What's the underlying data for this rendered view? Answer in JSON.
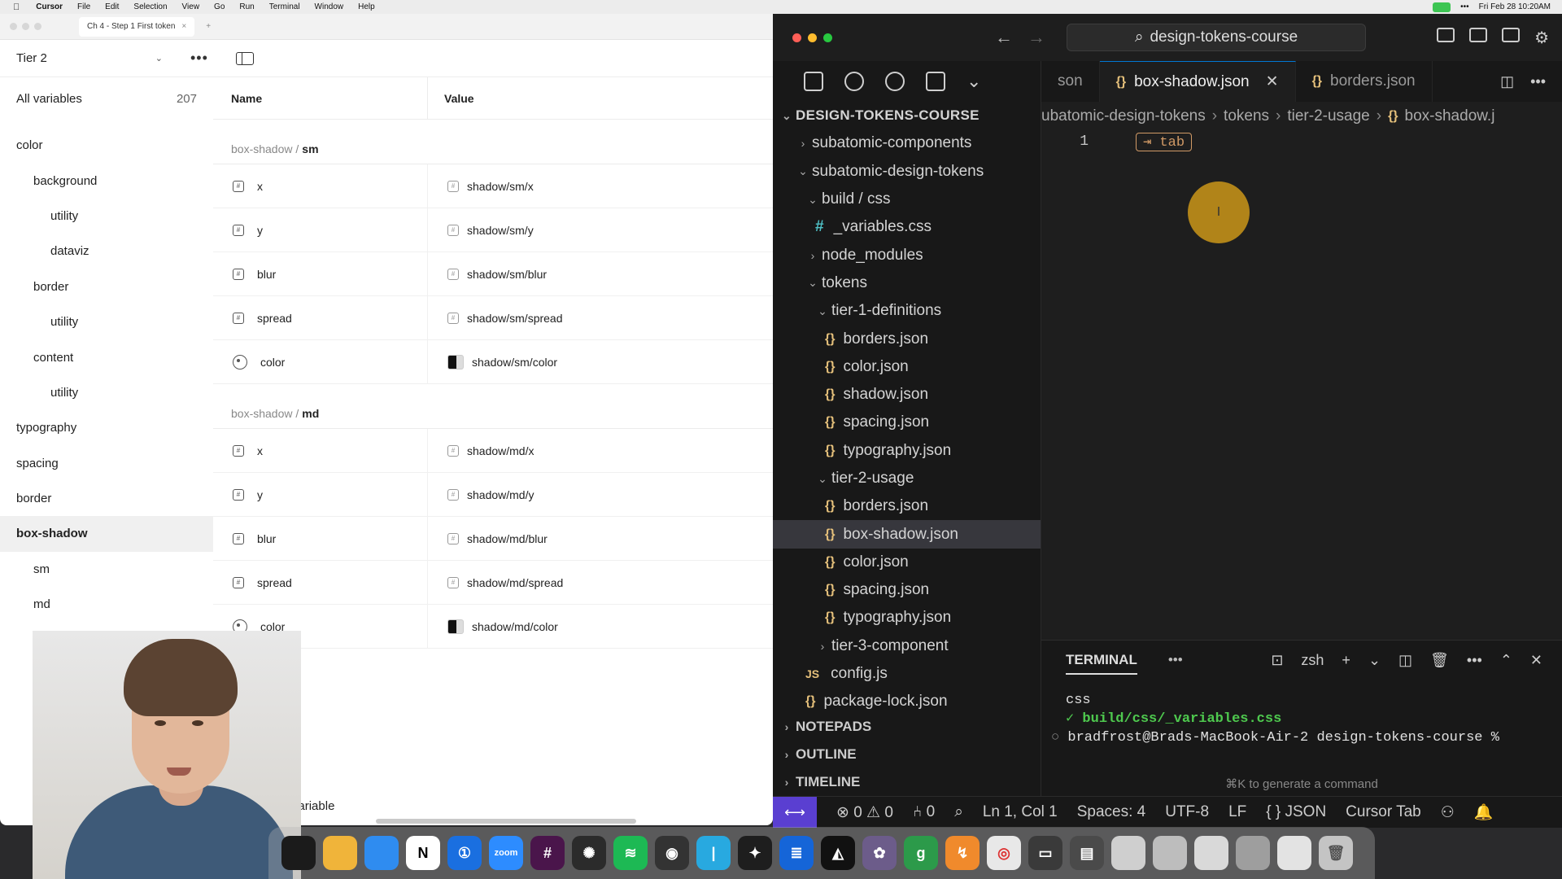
{
  "menubar": {
    "app": "Cursor",
    "items": [
      "File",
      "Edit",
      "Selection",
      "View",
      "Go",
      "Run",
      "Terminal",
      "Window",
      "Help"
    ],
    "clock": "Fri Feb 28  10:20AM"
  },
  "figma": {
    "tab_title": "Ch 4 - Step 1 First token",
    "mode": "Tier 2",
    "sidebar": {
      "all_variables_label": "All variables",
      "all_variables_count": "207",
      "groups": [
        {
          "label": "color",
          "level": 0
        },
        {
          "label": "background",
          "level": 1
        },
        {
          "label": "utility",
          "level": 2
        },
        {
          "label": "dataviz",
          "level": 2
        },
        {
          "label": "border",
          "level": 1
        },
        {
          "label": "utility",
          "level": 2
        },
        {
          "label": "content",
          "level": 1
        },
        {
          "label": "utility",
          "level": 2
        },
        {
          "label": "typography",
          "level": 0
        },
        {
          "label": "spacing",
          "level": 0
        },
        {
          "label": "border",
          "level": 0
        },
        {
          "label": "box-shadow",
          "level": 0,
          "active": true
        },
        {
          "label": "sm",
          "level": 1
        },
        {
          "label": "md",
          "level": 1
        }
      ]
    },
    "table": {
      "col_name": "Name",
      "col_value": "Value",
      "sections": [
        {
          "prefix": "box-shadow /",
          "name": "sm",
          "rows": [
            {
              "name": "x",
              "value": "shadow/sm/x",
              "kind": "number"
            },
            {
              "name": "y",
              "value": "shadow/sm/y",
              "kind": "number"
            },
            {
              "name": "blur",
              "value": "shadow/sm/blur",
              "kind": "number"
            },
            {
              "name": "spread",
              "value": "shadow/sm/spread",
              "kind": "number"
            },
            {
              "name": "color",
              "value": "shadow/sm/color",
              "kind": "color"
            }
          ]
        },
        {
          "prefix": "box-shadow /",
          "name": "md",
          "rows": [
            {
              "name": "x",
              "value": "shadow/md/x",
              "kind": "number"
            },
            {
              "name": "y",
              "value": "shadow/md/y",
              "kind": "number"
            },
            {
              "name": "blur",
              "value": "shadow/md/blur",
              "kind": "number"
            },
            {
              "name": "spread",
              "value": "shadow/md/spread",
              "kind": "number"
            },
            {
              "name": "color",
              "value": "shadow/md/color",
              "kind": "color"
            }
          ]
        }
      ],
      "create_label": "Create variable"
    }
  },
  "vscode": {
    "command_center": "design-tokens-course",
    "explorer": {
      "root": "DESIGN-TOKENS-COURSE",
      "items": [
        {
          "label": "subatomic-components",
          "depth": 1,
          "type": "folder",
          "open": false
        },
        {
          "label": "subatomic-design-tokens",
          "depth": 1,
          "type": "folder",
          "open": true
        },
        {
          "label": "build / css",
          "depth": 2,
          "type": "folder",
          "open": true
        },
        {
          "label": "_variables.css",
          "depth": 3,
          "type": "css"
        },
        {
          "label": "node_modules",
          "depth": 2,
          "type": "folder",
          "open": false
        },
        {
          "label": "tokens",
          "depth": 2,
          "type": "folder",
          "open": true
        },
        {
          "label": "tier-1-definitions",
          "depth": 3,
          "type": "folder",
          "open": true
        },
        {
          "label": "borders.json",
          "depth": 4,
          "type": "json"
        },
        {
          "label": "color.json",
          "depth": 4,
          "type": "json"
        },
        {
          "label": "shadow.json",
          "depth": 4,
          "type": "json"
        },
        {
          "label": "spacing.json",
          "depth": 4,
          "type": "json"
        },
        {
          "label": "typography.json",
          "depth": 4,
          "type": "json"
        },
        {
          "label": "tier-2-usage",
          "depth": 3,
          "type": "folder",
          "open": true
        },
        {
          "label": "borders.json",
          "depth": 4,
          "type": "json"
        },
        {
          "label": "box-shadow.json",
          "depth": 4,
          "type": "json",
          "selected": true
        },
        {
          "label": "color.json",
          "depth": 4,
          "type": "json"
        },
        {
          "label": "spacing.json",
          "depth": 4,
          "type": "json"
        },
        {
          "label": "typography.json",
          "depth": 4,
          "type": "json"
        },
        {
          "label": "tier-3-component",
          "depth": 3,
          "type": "folder",
          "open": false
        },
        {
          "label": "config.js",
          "depth": 2,
          "type": "js"
        },
        {
          "label": "package-lock.json",
          "depth": 2,
          "type": "json"
        }
      ],
      "bottom_sections": [
        "NOTEPADS",
        "OUTLINE",
        "TIMELINE"
      ]
    },
    "tabs": [
      {
        "label": "son",
        "active": false,
        "partial": true
      },
      {
        "label": "box-shadow.json",
        "active": true
      },
      {
        "label": "borders.json",
        "active": false
      }
    ],
    "breadcrumbs": [
      "ubatomic-design-tokens",
      "tokens",
      "tier-2-usage",
      "box-shadow.j"
    ],
    "editor": {
      "line_number": "1",
      "tab_hint": "⇥ tab"
    },
    "terminal": {
      "title": "TERMINAL",
      "shell": "zsh",
      "lines": [
        "css",
        "✓ build/css/_variables.css"
      ],
      "prompt": "bradfrost@Brads-MacBook-Air-2 design-tokens-course % ",
      "hint": "⌘K to generate a command"
    },
    "statusbar": {
      "errors": "⊗ 0 ⚠ 0",
      "ports": "⑃ 0",
      "position": "Ln 1, Col 1",
      "spaces": "Spaces: 4",
      "encoding": "UTF-8",
      "eol": "LF",
      "language": "{ } JSON",
      "cursor_tab": "Cursor Tab"
    }
  },
  "colors": {
    "json_icon": "#e5c07b",
    "accent": "#0078d4",
    "remote": "#5a3fd1",
    "cursor_highlight": "#d69e18"
  }
}
